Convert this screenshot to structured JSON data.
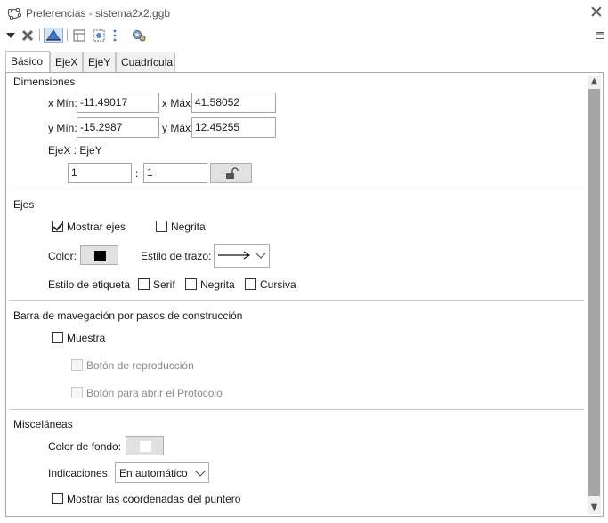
{
  "window": {
    "title": "Preferencias - sistema2x2.ggb",
    "close_icon": "close-icon"
  },
  "toolbar": {
    "icons": [
      "menu-dropdown-icon",
      "graphics-settings-icon",
      "graphics-view-icon",
      "layout-icon",
      "algebra-icon",
      "defaults-icon",
      "more-icon",
      "advanced-settings-icon"
    ],
    "selected": "graphics-view-icon"
  },
  "tabs": [
    "Básico",
    "EjeX",
    "EjeY",
    "Cuadrícula"
  ],
  "dimensions": {
    "title": "Dimensiones",
    "xmin_label": "x Mín:",
    "xmin_value": "-11.49017",
    "xmax_label": "x Máx:",
    "xmax_value": "41.58052",
    "ymin_label": "y Mín:",
    "ymin_value": "-15.2987",
    "ymax_label": "y Máx:",
    "ymax_value": "12.45255",
    "ratio_label": "EjeX : EjeY",
    "ratio_x": "1",
    "ratio_sep": ":",
    "ratio_y": "1",
    "lock_icon": "unlock-icon"
  },
  "axes": {
    "title": "Ejes",
    "show_axes_label": "Mostrar ejes",
    "show_axes_checked": true,
    "bold_label": "Negrita",
    "bold_checked": false,
    "color_label": "Color:",
    "color_value": "#000000",
    "line_style_label": "Estilo de trazo:",
    "label_style_label": "Estilo de etiqueta",
    "serif_label": "Serif",
    "label_bold_label": "Negrita",
    "italic_label": "Cursiva"
  },
  "navigation": {
    "title": "Barra de mavegación por pasos de construcción",
    "show_label": "Muestra",
    "play_label": "Botón de reproducción",
    "protocol_label": "Botón para abrir el Protocolo"
  },
  "misc": {
    "title": "Misceláneas",
    "bg_color_label": "Color de fondo:",
    "bg_color_value": "#ffffff",
    "tooltips_label": "Indicaciones:",
    "tooltips_value": "En automático",
    "show_coords_label": "Mostrar las coordenadas del puntero"
  }
}
